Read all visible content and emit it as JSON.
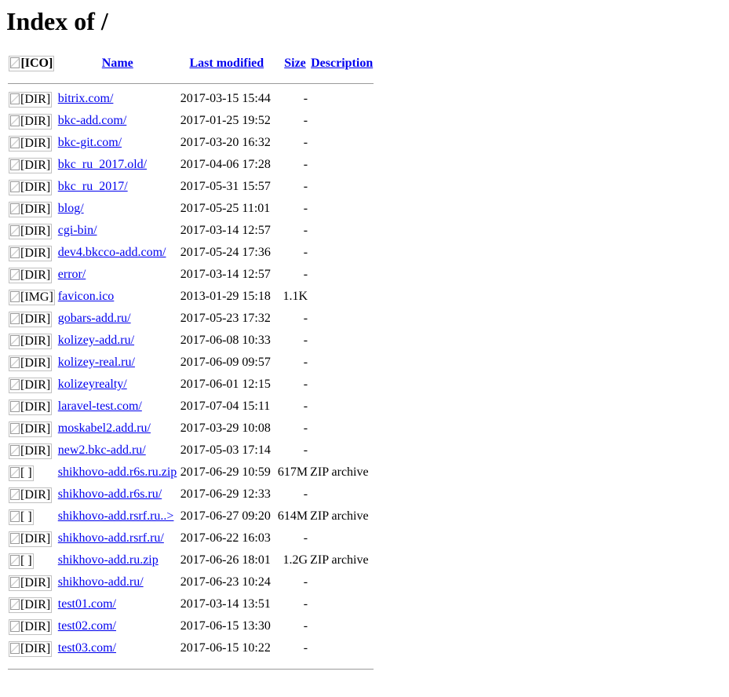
{
  "page": {
    "title": "Index of /"
  },
  "columns": {
    "icon_alt": "[ICO]",
    "name": "Name",
    "last_modified": "Last modified",
    "size": "Size",
    "description": "Description"
  },
  "entries": [
    {
      "icon": "[DIR]",
      "name": "bitrix.com/",
      "modified": "2017-03-15 15:44",
      "size": "-",
      "description": ""
    },
    {
      "icon": "[DIR]",
      "name": "bkc-add.com/",
      "modified": "2017-01-25 19:52",
      "size": "-",
      "description": ""
    },
    {
      "icon": "[DIR]",
      "name": "bkc-git.com/",
      "modified": "2017-03-20 16:32",
      "size": "-",
      "description": ""
    },
    {
      "icon": "[DIR]",
      "name": "bkc_ru_2017.old/",
      "modified": "2017-04-06 17:28",
      "size": "-",
      "description": ""
    },
    {
      "icon": "[DIR]",
      "name": "bkc_ru_2017/",
      "modified": "2017-05-31 15:57",
      "size": "-",
      "description": ""
    },
    {
      "icon": "[DIR]",
      "name": "blog/",
      "modified": "2017-05-25 11:01",
      "size": "-",
      "description": ""
    },
    {
      "icon": "[DIR]",
      "name": "cgi-bin/",
      "modified": "2017-03-14 12:57",
      "size": "-",
      "description": ""
    },
    {
      "icon": "[DIR]",
      "name": "dev4.bkcco-add.com/",
      "modified": "2017-05-24 17:36",
      "size": "-",
      "description": ""
    },
    {
      "icon": "[DIR]",
      "name": "error/",
      "modified": "2017-03-14 12:57",
      "size": "-",
      "description": ""
    },
    {
      "icon": "[IMG]",
      "name": "favicon.ico",
      "modified": "2013-01-29 15:18",
      "size": "1.1K",
      "description": ""
    },
    {
      "icon": "[DIR]",
      "name": "gobars-add.ru/",
      "modified": "2017-05-23 17:32",
      "size": "-",
      "description": ""
    },
    {
      "icon": "[DIR]",
      "name": "kolizey-add.ru/",
      "modified": "2017-06-08 10:33",
      "size": "-",
      "description": ""
    },
    {
      "icon": "[DIR]",
      "name": "kolizey-real.ru/",
      "modified": "2017-06-09 09:57",
      "size": "-",
      "description": ""
    },
    {
      "icon": "[DIR]",
      "name": "kolizeyrealty/",
      "modified": "2017-06-01 12:15",
      "size": "-",
      "description": ""
    },
    {
      "icon": "[DIR]",
      "name": "laravel-test.com/",
      "modified": "2017-07-04 15:11",
      "size": "-",
      "description": ""
    },
    {
      "icon": "[DIR]",
      "name": "moskabel2.add.ru/",
      "modified": "2017-03-29 10:08",
      "size": "-",
      "description": ""
    },
    {
      "icon": "[DIR]",
      "name": "new2.bkc-add.ru/",
      "modified": "2017-05-03 17:14",
      "size": "-",
      "description": ""
    },
    {
      "icon": "[ ]",
      "name": "shikhovo-add.r6s.ru.zip",
      "modified": "2017-06-29 10:59",
      "size": "617M",
      "description": "ZIP archive"
    },
    {
      "icon": "[DIR]",
      "name": "shikhovo-add.r6s.ru/",
      "modified": "2017-06-29 12:33",
      "size": "-",
      "description": ""
    },
    {
      "icon": "[ ]",
      "name": "shikhovo-add.rsrf.ru..>",
      "modified": "2017-06-27 09:20",
      "size": "614M",
      "description": "ZIP archive"
    },
    {
      "icon": "[DIR]",
      "name": "shikhovo-add.rsrf.ru/",
      "modified": "2017-06-22 16:03",
      "size": "-",
      "description": ""
    },
    {
      "icon": "[ ]",
      "name": "shikhovo-add.ru.zip",
      "modified": "2017-06-26 18:01",
      "size": "1.2G",
      "description": "ZIP archive"
    },
    {
      "icon": "[DIR]",
      "name": "shikhovo-add.ru/",
      "modified": "2017-06-23 10:24",
      "size": "-",
      "description": ""
    },
    {
      "icon": "[DIR]",
      "name": "test01.com/",
      "modified": "2017-03-14 13:51",
      "size": "-",
      "description": ""
    },
    {
      "icon": "[DIR]",
      "name": "test02.com/",
      "modified": "2017-06-15 13:30",
      "size": "-",
      "description": ""
    },
    {
      "icon": "[DIR]",
      "name": "test03.com/",
      "modified": "2017-06-15 10:22",
      "size": "-",
      "description": ""
    }
  ],
  "colors": {
    "link": "#0000ee",
    "rule": "#9a9a9a",
    "icon_border": "#c0c0c0"
  }
}
